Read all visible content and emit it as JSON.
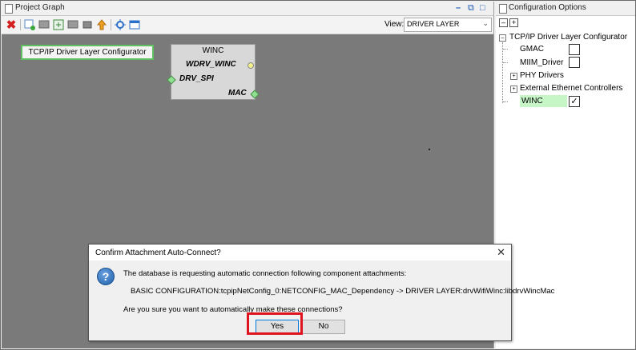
{
  "project_graph": {
    "title": "Project Graph",
    "view_label": "View:",
    "view_value": "DRIVER LAYER",
    "toolbar_icons": [
      "delete-icon",
      "add-component-icon",
      "component-icon",
      "export-icon",
      "component-icon",
      "import-icon",
      "arrow-up-icon",
      "connect-icon",
      "window-icon"
    ]
  },
  "canvas": {
    "config_node_label": "TCP/IP Driver Layer Configurator",
    "winc_node": {
      "title": "WINC",
      "port_out": "WDRV_WINC",
      "port_in": "DRV_SPI",
      "port_mac": "MAC"
    }
  },
  "config_options": {
    "title": "Configuration Options",
    "root": "TCP/IP Driver Layer Configurator",
    "items": [
      {
        "label": "GMAC",
        "checked": false
      },
      {
        "label": "MIIM_Driver",
        "checked": false
      },
      {
        "label": "PHY Drivers"
      },
      {
        "label": "External Ethernet Controllers"
      },
      {
        "label": "WINC",
        "checked": true
      }
    ],
    "highlight_color": "#c6f5c6"
  },
  "dialog": {
    "title": "Confirm Attachment Auto-Connect?",
    "line1": "The database is requesting automatic connection following component attachments:",
    "line2": "BASIC CONFIGURATION:tcpipNetConfig_0:NETCONFIG_MAC_Dependency -> DRIVER LAYER:drvWifiWinc:libdrvWincMac",
    "line3": "Are you sure you want to automatically make these connections?",
    "yes": "Yes",
    "no": "No",
    "close_glyph": "✕",
    "question_glyph": "?"
  },
  "colors": {
    "canvas": "#7a7a7a",
    "accent_red": "#e0141e",
    "select_blue": "#0078d7"
  }
}
